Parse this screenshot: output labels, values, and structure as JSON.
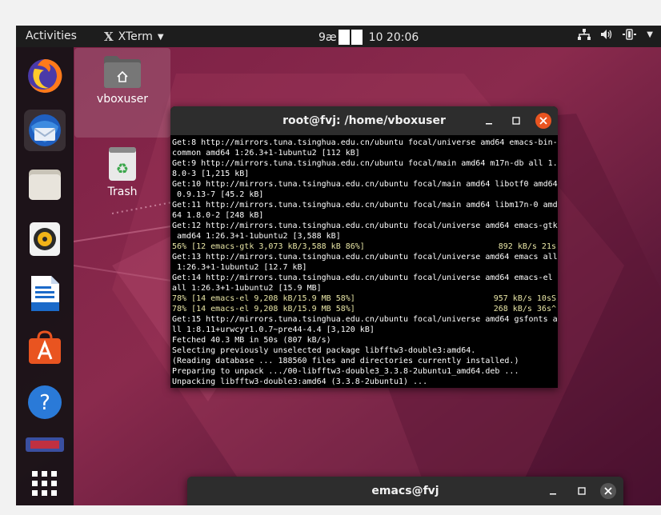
{
  "topbar": {
    "activities": "Activities",
    "app_name": "XTerm",
    "clock_prefix": "9æ",
    "clock_suffix": "10 20:06"
  },
  "desktop": {
    "home_label": "vboxuser",
    "trash_label": "Trash"
  },
  "terminal": {
    "title": "root@fvj: /home/vboxuser",
    "lines": [
      {
        "text": "Get:8 http://mirrors.tuna.tsinghua.edu.cn/ubuntu focal/universe amd64 emacs-bin-",
        "right": ""
      },
      {
        "text": "common amd64 1:26.3+1-1ubuntu2 [112 kB]",
        "right": ""
      },
      {
        "text": "Get:9 http://mirrors.tuna.tsinghua.edu.cn/ubuntu focal/main amd64 m17n-db all 1.",
        "right": ""
      },
      {
        "text": "8.0-3 [1,215 kB]",
        "right": ""
      },
      {
        "text": "Get:10 http://mirrors.tuna.tsinghua.edu.cn/ubuntu focal/main amd64 libotf0 amd64",
        "right": ""
      },
      {
        "text": " 0.9.13-7 [45.2 kB]",
        "right": ""
      },
      {
        "text": "Get:11 http://mirrors.tuna.tsinghua.edu.cn/ubuntu focal/main amd64 libm17n-0 amd",
        "right": ""
      },
      {
        "text": "64 1.8.0-2 [248 kB]",
        "right": ""
      },
      {
        "text": "Get:12 http://mirrors.tuna.tsinghua.edu.cn/ubuntu focal/universe amd64 emacs-gtk",
        "right": ""
      },
      {
        "text": " amd64 1:26.3+1-1ubuntu2 [3,588 kB]",
        "right": ""
      },
      {
        "text": "56% [12 emacs-gtk 3,073 kB/3,588 kB 86%]",
        "right": "892 kB/s 21s",
        "progress": true
      },
      {
        "text": "Get:13 http://mirrors.tuna.tsinghua.edu.cn/ubuntu focal/universe amd64 emacs all",
        "right": ""
      },
      {
        "text": " 1:26.3+1-1ubuntu2 [12.7 kB]",
        "right": ""
      },
      {
        "text": "Get:14 http://mirrors.tuna.tsinghua.edu.cn/ubuntu focal/universe amd64 emacs-el",
        "right": ""
      },
      {
        "text": "all 1:26.3+1-1ubuntu2 [15.9 MB]",
        "right": ""
      },
      {
        "text": "78% [14 emacs-el 9,208 kB/15.9 MB 58%]",
        "right": "957 kB/s 10sS",
        "progress": true
      },
      {
        "text": "78% [14 emacs-el 9,208 kB/15.9 MB 58%]",
        "right": "268 kB/s 36s^",
        "progress": true
      },
      {
        "text": "Get:15 http://mirrors.tuna.tsinghua.edu.cn/ubuntu focal/universe amd64 gsfonts a",
        "right": ""
      },
      {
        "text": "ll 1:8.11+urwcyr1.0.7~pre44-4.4 [3,120 kB]",
        "right": ""
      },
      {
        "text": "Fetched 40.3 MB in 50s (807 kB/s)",
        "right": ""
      },
      {
        "text": "Selecting previously unselected package libfftw3-double3:amd64.",
        "right": ""
      },
      {
        "text": "(Reading database ... 188560 files and directories currently installed.)",
        "right": ""
      },
      {
        "text": "Preparing to unpack .../00-libfftw3-double3_3.3.8-2ubuntu1_amd64.deb ...",
        "right": ""
      },
      {
        "text": "Unpacking libfftw3-double3:amd64 (3.3.8-2ubuntu1) ...",
        "right": ""
      }
    ]
  },
  "emacs": {
    "title": "emacs@fvj"
  },
  "colors": {
    "topbar_bg": "#1d1d1d",
    "titlebar_bg": "#2d2d2d",
    "close_button": "#e95420",
    "progress_text": "#e9e6a6"
  }
}
